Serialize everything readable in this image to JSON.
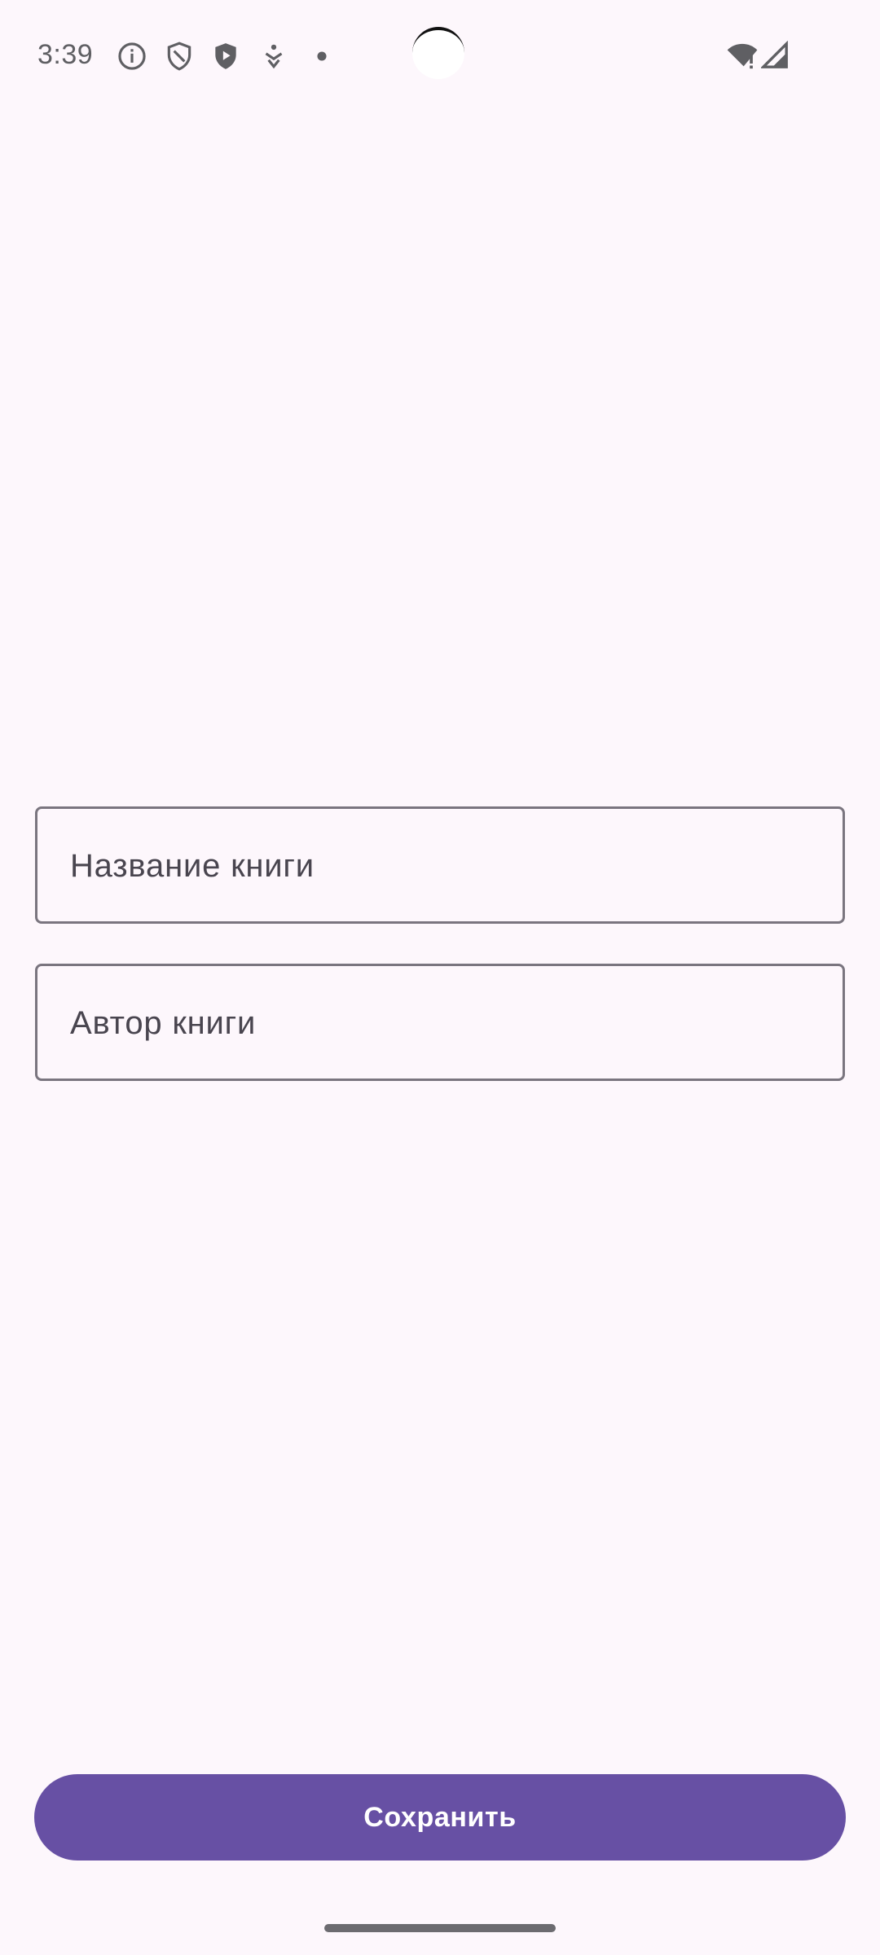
{
  "status_bar": {
    "time": "3:39",
    "icons": [
      "info-icon",
      "shield-icon",
      "play-shield-icon",
      "accessibility-icon",
      "dot-icon"
    ],
    "right_icons": [
      "wifi-alert-icon",
      "signal-icon"
    ]
  },
  "form": {
    "title_placeholder": "Название книги",
    "author_placeholder": "Автор книги"
  },
  "actions": {
    "save_label": "Сохранить"
  },
  "colors": {
    "background": "#FDF7FC",
    "primary": "#6750A4",
    "outline": "#7A757F",
    "on_surface_variant": "#49454F"
  }
}
